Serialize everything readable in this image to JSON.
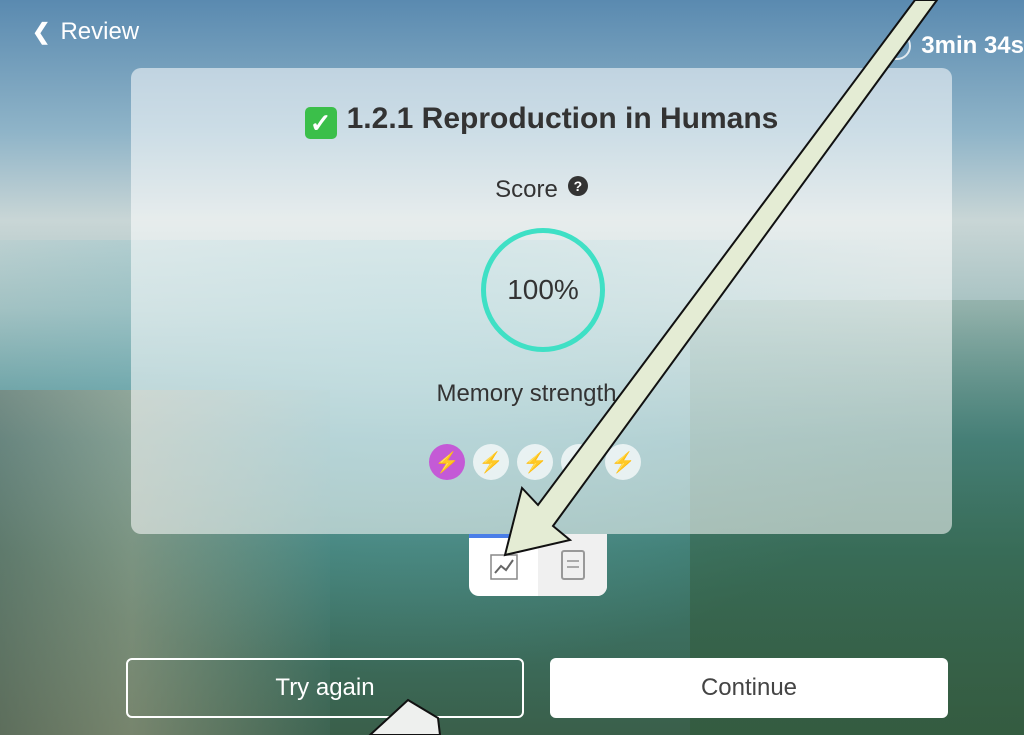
{
  "header": {
    "back_label": "Review",
    "timer": "3min 34s"
  },
  "result": {
    "title": "1.2.1 Reproduction in Humans",
    "score_label": "Score",
    "score_value": "100%",
    "memory_label": "Memory strength",
    "memory_level": 1,
    "memory_max": 5
  },
  "tabs": [
    {
      "name": "chart-icon",
      "active": true
    },
    {
      "name": "document-icon",
      "active": false
    }
  ],
  "actions": {
    "try_again": "Try again",
    "continue": "Continue"
  },
  "colors": {
    "score_ring": "#3fe0c5",
    "memory_active": "#c45ad6",
    "tab_active_border": "#4a7ee8",
    "check": "#3bbf4a",
    "arrow_fill": "#e8f0d8"
  }
}
